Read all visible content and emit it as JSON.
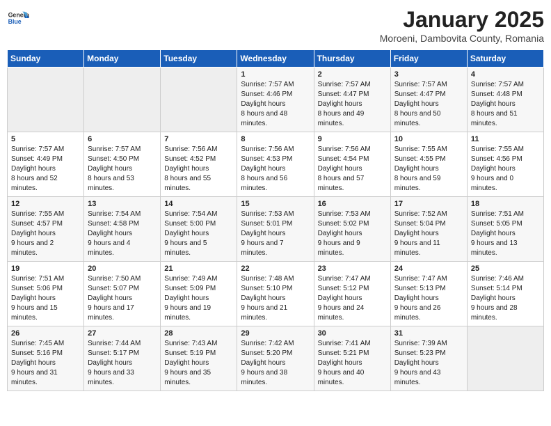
{
  "logo": {
    "line1": "General",
    "line2": "Blue"
  },
  "title": "January 2025",
  "subtitle": "Moroeni, Dambovita County, Romania",
  "weekdays": [
    "Sunday",
    "Monday",
    "Tuesday",
    "Wednesday",
    "Thursday",
    "Friday",
    "Saturday"
  ],
  "weeks": [
    [
      {
        "day": "",
        "sunrise": "",
        "sunset": "",
        "daylight": ""
      },
      {
        "day": "",
        "sunrise": "",
        "sunset": "",
        "daylight": ""
      },
      {
        "day": "",
        "sunrise": "",
        "sunset": "",
        "daylight": ""
      },
      {
        "day": "1",
        "sunrise": "7:57 AM",
        "sunset": "4:46 PM",
        "daylight": "8 hours and 48 minutes."
      },
      {
        "day": "2",
        "sunrise": "7:57 AM",
        "sunset": "4:47 PM",
        "daylight": "8 hours and 49 minutes."
      },
      {
        "day": "3",
        "sunrise": "7:57 AM",
        "sunset": "4:47 PM",
        "daylight": "8 hours and 50 minutes."
      },
      {
        "day": "4",
        "sunrise": "7:57 AM",
        "sunset": "4:48 PM",
        "daylight": "8 hours and 51 minutes."
      }
    ],
    [
      {
        "day": "5",
        "sunrise": "7:57 AM",
        "sunset": "4:49 PM",
        "daylight": "8 hours and 52 minutes."
      },
      {
        "day": "6",
        "sunrise": "7:57 AM",
        "sunset": "4:50 PM",
        "daylight": "8 hours and 53 minutes."
      },
      {
        "day": "7",
        "sunrise": "7:56 AM",
        "sunset": "4:52 PM",
        "daylight": "8 hours and 55 minutes."
      },
      {
        "day": "8",
        "sunrise": "7:56 AM",
        "sunset": "4:53 PM",
        "daylight": "8 hours and 56 minutes."
      },
      {
        "day": "9",
        "sunrise": "7:56 AM",
        "sunset": "4:54 PM",
        "daylight": "8 hours and 57 minutes."
      },
      {
        "day": "10",
        "sunrise": "7:55 AM",
        "sunset": "4:55 PM",
        "daylight": "8 hours and 59 minutes."
      },
      {
        "day": "11",
        "sunrise": "7:55 AM",
        "sunset": "4:56 PM",
        "daylight": "9 hours and 0 minutes."
      }
    ],
    [
      {
        "day": "12",
        "sunrise": "7:55 AM",
        "sunset": "4:57 PM",
        "daylight": "9 hours and 2 minutes."
      },
      {
        "day": "13",
        "sunrise": "7:54 AM",
        "sunset": "4:58 PM",
        "daylight": "9 hours and 4 minutes."
      },
      {
        "day": "14",
        "sunrise": "7:54 AM",
        "sunset": "5:00 PM",
        "daylight": "9 hours and 5 minutes."
      },
      {
        "day": "15",
        "sunrise": "7:53 AM",
        "sunset": "5:01 PM",
        "daylight": "9 hours and 7 minutes."
      },
      {
        "day": "16",
        "sunrise": "7:53 AM",
        "sunset": "5:02 PM",
        "daylight": "9 hours and 9 minutes."
      },
      {
        "day": "17",
        "sunrise": "7:52 AM",
        "sunset": "5:04 PM",
        "daylight": "9 hours and 11 minutes."
      },
      {
        "day": "18",
        "sunrise": "7:51 AM",
        "sunset": "5:05 PM",
        "daylight": "9 hours and 13 minutes."
      }
    ],
    [
      {
        "day": "19",
        "sunrise": "7:51 AM",
        "sunset": "5:06 PM",
        "daylight": "9 hours and 15 minutes."
      },
      {
        "day": "20",
        "sunrise": "7:50 AM",
        "sunset": "5:07 PM",
        "daylight": "9 hours and 17 minutes."
      },
      {
        "day": "21",
        "sunrise": "7:49 AM",
        "sunset": "5:09 PM",
        "daylight": "9 hours and 19 minutes."
      },
      {
        "day": "22",
        "sunrise": "7:48 AM",
        "sunset": "5:10 PM",
        "daylight": "9 hours and 21 minutes."
      },
      {
        "day": "23",
        "sunrise": "7:47 AM",
        "sunset": "5:12 PM",
        "daylight": "9 hours and 24 minutes."
      },
      {
        "day": "24",
        "sunrise": "7:47 AM",
        "sunset": "5:13 PM",
        "daylight": "9 hours and 26 minutes."
      },
      {
        "day": "25",
        "sunrise": "7:46 AM",
        "sunset": "5:14 PM",
        "daylight": "9 hours and 28 minutes."
      }
    ],
    [
      {
        "day": "26",
        "sunrise": "7:45 AM",
        "sunset": "5:16 PM",
        "daylight": "9 hours and 31 minutes."
      },
      {
        "day": "27",
        "sunrise": "7:44 AM",
        "sunset": "5:17 PM",
        "daylight": "9 hours and 33 minutes."
      },
      {
        "day": "28",
        "sunrise": "7:43 AM",
        "sunset": "5:19 PM",
        "daylight": "9 hours and 35 minutes."
      },
      {
        "day": "29",
        "sunrise": "7:42 AM",
        "sunset": "5:20 PM",
        "daylight": "9 hours and 38 minutes."
      },
      {
        "day": "30",
        "sunrise": "7:41 AM",
        "sunset": "5:21 PM",
        "daylight": "9 hours and 40 minutes."
      },
      {
        "day": "31",
        "sunrise": "7:39 AM",
        "sunset": "5:23 PM",
        "daylight": "9 hours and 43 minutes."
      },
      {
        "day": "",
        "sunrise": "",
        "sunset": "",
        "daylight": ""
      }
    ]
  ]
}
